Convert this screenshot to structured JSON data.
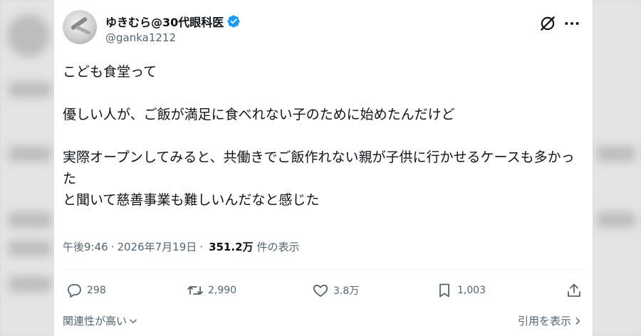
{
  "tweet": {
    "display_name": "ゆきむら@30代眼科医",
    "handle": "@ganka1212",
    "verified": true,
    "text": "こども食堂って\n\n優しい人が、ご飯が満足に食べれない子のために始めたんだけど\n\n実際オープンしてみると、共働きでご飯作れない親が子供に行かせるケースも多かった\nと聞いて慈善事業も難しいんだなと感じた",
    "time": "午後9:46",
    "date": "2026年7月19日",
    "views": "351.2万",
    "views_label": "件の表示",
    "separator": "·"
  },
  "actions": {
    "replies": "298",
    "retweets": "2,990",
    "likes": "3.8万",
    "bookmarks": "1,003"
  },
  "footer": {
    "related": "関連性が高い",
    "quotes": "引用を表示"
  },
  "colors": {
    "verified": "#1d9bf0",
    "muted": "#536471",
    "text": "#0f1419"
  },
  "icons": [
    "grok-icon",
    "more-icon",
    "reply-icon",
    "retweet-icon",
    "like-icon",
    "bookmark-icon",
    "share-icon",
    "chevron-down-icon",
    "chevron-right-icon",
    "verified-badge-icon"
  ]
}
